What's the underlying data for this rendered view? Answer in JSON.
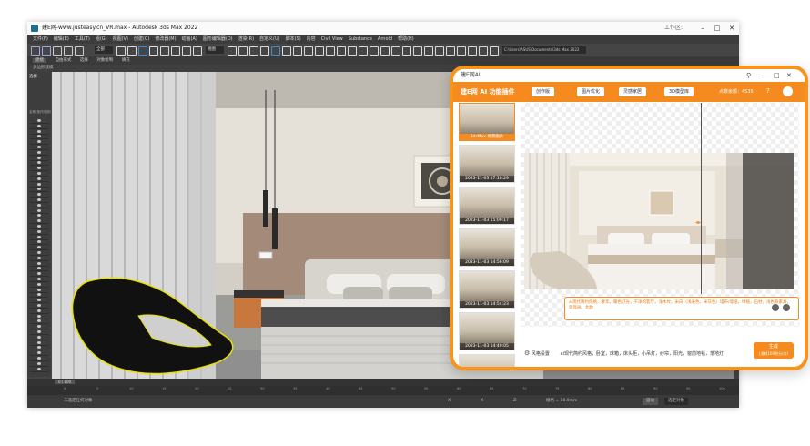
{
  "max_window": {
    "title": "建E网-www.justeasy.cn_VR.max - Autodesk 3ds Max 2022",
    "workspace": "工作区:",
    "menu": [
      "文件(F)",
      "编辑(E)",
      "工具(T)",
      "组(G)",
      "视图(V)",
      "创建(C)",
      "修改器(M)",
      "动画(A)",
      "图形编辑器(D)",
      "渲染(R)",
      "自定义(U)",
      "脚本(S)",
      "内容",
      "Civil View",
      "Substance",
      "Arnold",
      "帮助(H)"
    ],
    "path_field": "C:\\Users\\ASUS\\Documents\\3ds Max 2022",
    "selection_dropdown": "全部",
    "view_dropdown": "视图",
    "ribbon_tabs": [
      "建模",
      "自由形式",
      "选择",
      "对象绘制",
      "填充"
    ],
    "ribbon_sub": "多边形建模",
    "scene_label": "选择",
    "scene_header": "名称(按升序排序)",
    "frame_counter": "0 / 100",
    "status_left": "未选定任何对象",
    "coord_x": "X:",
    "coord_y": "Y:",
    "coord_z": "Z:",
    "grid": "栅格 = 10.0mm",
    "mode": "自动",
    "set_key": "选定对象",
    "timeline_ticks": [
      "0",
      "5",
      "10",
      "15",
      "20",
      "25",
      "30",
      "35",
      "40",
      "45",
      "50",
      "55",
      "60",
      "65",
      "70",
      "75",
      "80",
      "85",
      "90",
      "95",
      "100"
    ]
  },
  "ai_panel": {
    "window_title": "建E网AI",
    "brand": "建E网 AI 功能插件",
    "dropdowns": [
      "创作版",
      "图片优化",
      "灵感家居",
      "3D模型库"
    ],
    "credits": "点数余额：4535",
    "thumbnails": [
      {
        "label": "3dsMax 场景图片",
        "active": true
      },
      {
        "label": "2023-11-03 17:10:29",
        "active": false
      },
      {
        "label": "2023-11-03 15:09:17",
        "active": false
      },
      {
        "label": "2023-11-03 14:56:09",
        "active": false
      },
      {
        "label": "2023-11-03 14:54:23",
        "active": false
      },
      {
        "label": "2023-11-03 14:40:05",
        "active": false
      },
      {
        "label": "",
        "active": false
      }
    ],
    "prompt_text": "ai现代简约风格，奢华，暖色灯光，干净的客厅，浅木纹，米白（浅米色，米灰色）墙布/墙纸，绿植，石材，浅色系家具，装饰画，北欧",
    "style_label": "风格设置",
    "style_value": "ai现代简约风格，卧室，床箱，床头柜，小吊灯，纱帘，阳光，窗前地毯，落地灯",
    "generate_label": "生成",
    "generate_sub": "(消耗100积分/次)",
    "accent_color": "#f58a1f"
  }
}
